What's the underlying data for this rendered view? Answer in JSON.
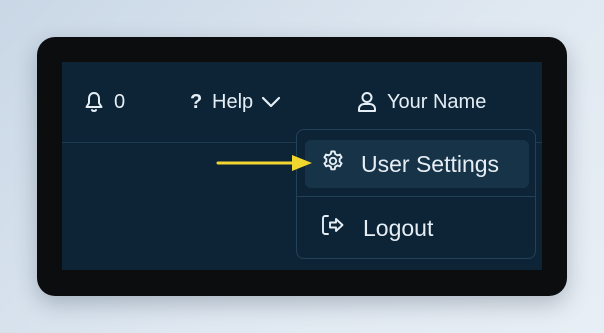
{
  "topbar": {
    "notifications": {
      "icon": "bell-icon",
      "count": "0"
    },
    "help": {
      "icon": "question-mark-icon",
      "mark": "?",
      "label": "Help",
      "chevron": "chevron-down-icon"
    },
    "user": {
      "icon": "user-icon",
      "label": "Your Name"
    }
  },
  "user_menu": {
    "items": [
      {
        "icon": "gear-icon",
        "label": "User Settings",
        "highlighted": true
      },
      {
        "icon": "logout-icon",
        "label": "Logout",
        "highlighted": false
      }
    ]
  },
  "annotation": {
    "icon": "arrow-right-icon",
    "color": "#f2d630",
    "points_to": "User Settings"
  },
  "colors": {
    "app_background": "#0c2436",
    "frame": "#0b0d0e",
    "text": "#e6eef5",
    "highlight": "#173347",
    "border": "#244257",
    "arrow": "#f2d630"
  }
}
